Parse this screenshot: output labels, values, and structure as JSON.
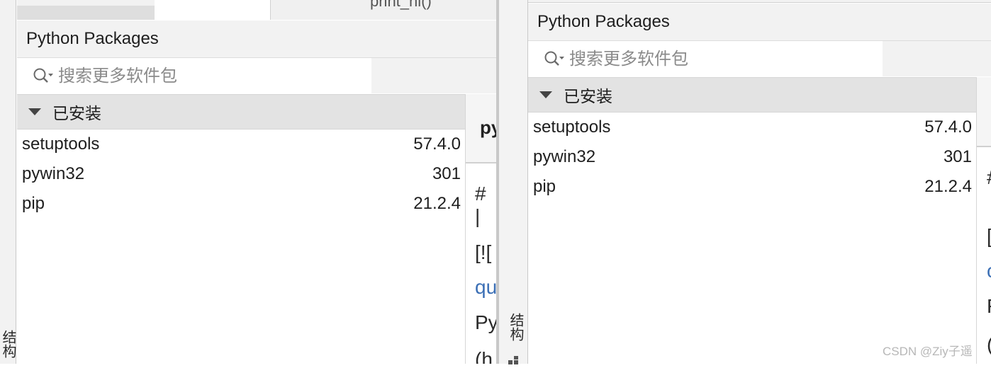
{
  "top_tab": {
    "label": "print_hi()"
  },
  "left_panel": {
    "vertical_label": "结构",
    "title": "Python Packages",
    "search": {
      "placeholder": "搜索更多软件包"
    },
    "section": {
      "label": "已安装"
    },
    "packages": [
      {
        "name": "setuptools",
        "version": "57.4.0"
      },
      {
        "name": "pywin32",
        "version": "301"
      },
      {
        "name": "pip",
        "version": "21.2.4"
      }
    ]
  },
  "editor_fragment": {
    "heading": "py",
    "lines": [
      "# |",
      "[![",
      "qu",
      "Py",
      "(h"
    ]
  },
  "right_panel": {
    "vertical_label": "结构",
    "title": "Python Packages",
    "search": {
      "placeholder": "搜索更多软件包"
    },
    "section": {
      "label": "已安装"
    },
    "packages": [
      {
        "name": "setuptools",
        "version": "57.4.0"
      },
      {
        "name": "pywin32",
        "version": "301"
      },
      {
        "name": "pip",
        "version": "21.2.4"
      }
    ]
  },
  "right_edge_fragment": {
    "lines": [
      "#",
      "[",
      "c",
      "F",
      "("
    ]
  },
  "watermark": "CSDN @Ziy子遥"
}
